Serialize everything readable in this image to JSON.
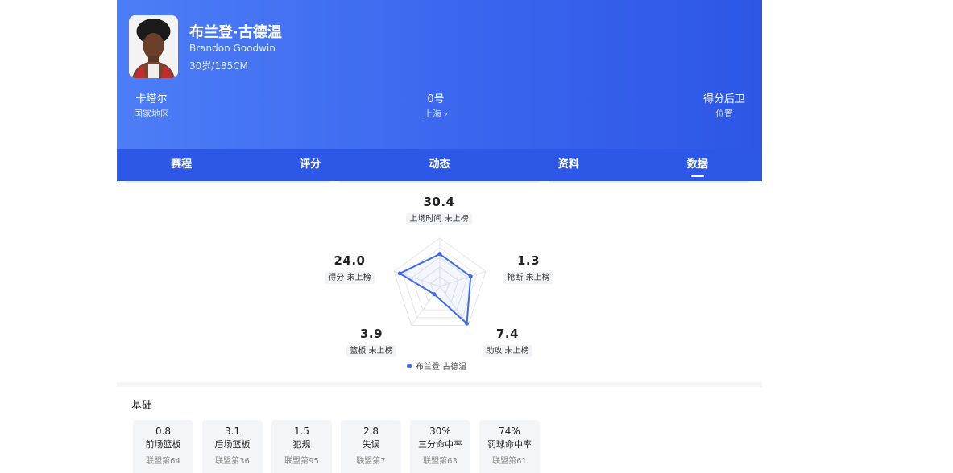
{
  "player": {
    "name_cn": "布兰登·古德温",
    "name_en": "Brandon Goodwin",
    "info": "30岁/185CM"
  },
  "stats": [
    {
      "value": "卡塔尔",
      "label": "国家地区"
    },
    {
      "value": "0号",
      "label": "上海 ›"
    },
    {
      "value": "得分后卫",
      "label": "位置"
    }
  ],
  "tabs": [
    "赛程",
    "评分",
    "动态",
    "资料",
    "数据"
  ],
  "active_tab": "数据",
  "radar": {
    "axes": [
      {
        "key": "minutes",
        "value": "30.4",
        "label": "上场时间 未上榜",
        "ratio": 0.67
      },
      {
        "key": "steals",
        "value": "1.3",
        "label": "抢断 未上榜",
        "ratio": 0.67
      },
      {
        "key": "assists",
        "value": "7.4",
        "label": "助攻 未上榜",
        "ratio": 0.95
      },
      {
        "key": "rebounds",
        "value": "3.9",
        "label": "篮板 未上榜",
        "ratio": 0.2
      },
      {
        "key": "points",
        "value": "24.0",
        "label": "得分 未上榜",
        "ratio": 0.87
      }
    ],
    "legend": "布兰登·古德温",
    "series_color": "#3d6af2"
  },
  "basic": {
    "title": "基础",
    "items": [
      {
        "value": "0.8",
        "label": "前场篮板",
        "rank": "联盟第64"
      },
      {
        "value": "3.1",
        "label": "后场篮板",
        "rank": "联盟第36"
      },
      {
        "value": "1.5",
        "label": "犯规",
        "rank": "联盟第95"
      },
      {
        "value": "2.8",
        "label": "失误",
        "rank": "联盟第7"
      },
      {
        "value": "30%",
        "label": "三分命中率",
        "rank": "联盟第63"
      },
      {
        "value": "74%",
        "label": "罚球命中率",
        "rank": "联盟第61"
      }
    ]
  },
  "colors": {
    "header_blue": "#3a66ee",
    "tab_blue": "#2d58e7",
    "accent": "#3d6af2"
  }
}
